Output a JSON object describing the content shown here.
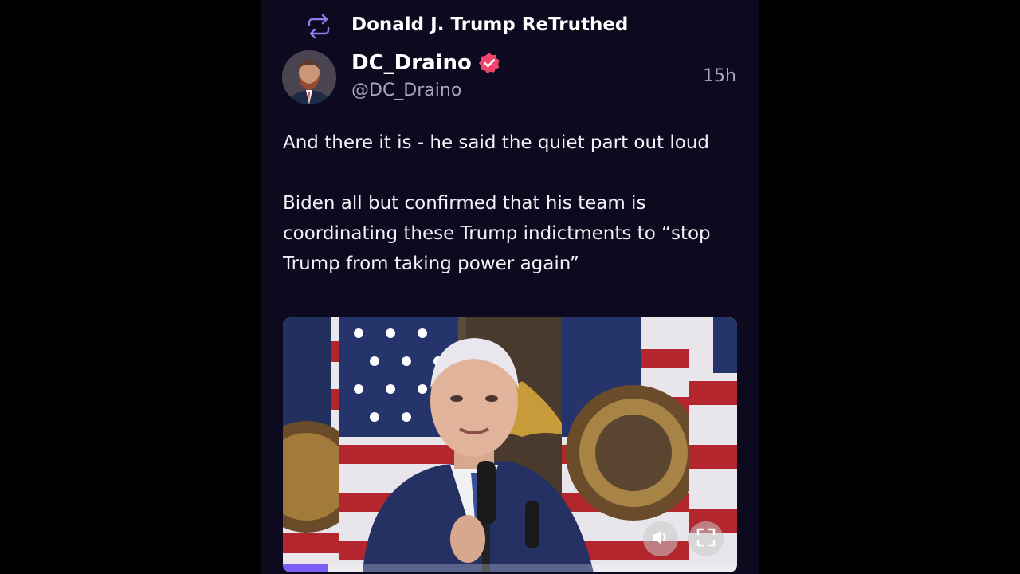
{
  "retruth": {
    "label": "Donald J. Trump ReTruthed",
    "icon": "retruth-icon"
  },
  "author": {
    "display_name": "DC_Draino",
    "handle": "@DC_Draino",
    "verified": true,
    "verified_color": "#f0466e"
  },
  "post": {
    "timestamp": "15h",
    "paragraphs": [
      "And there it is - he said the quiet part out loud",
      "Biden all but confirmed that his team is coordinating these Trump indictments to “stop Trump from taking power again”"
    ]
  },
  "video": {
    "progress": 0.1,
    "mute_icon": "volume-icon",
    "fullscreen_icon": "fullscreen-icon"
  },
  "colors": {
    "panel_bg": "#0d0a1f",
    "accent": "#7b5cf5",
    "text_secondary": "#a9a6b7"
  }
}
